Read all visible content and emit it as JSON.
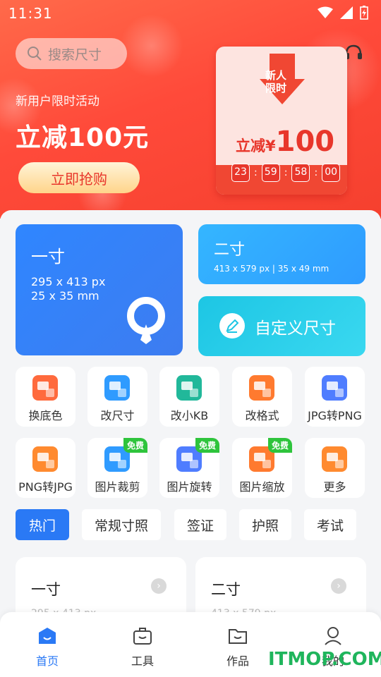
{
  "status": {
    "time": "11:31"
  },
  "search": {
    "placeholder": "搜索尺寸"
  },
  "promo": {
    "subtitle": "新用户限时活动",
    "title": "立减100元",
    "button": "立即抢购",
    "coupon_tag_line1": "新人",
    "coupon_tag_line2": "限时",
    "coupon_price_prefix": "立减¥",
    "coupon_price": "100",
    "timer": [
      "23",
      "59",
      "58",
      "00"
    ]
  },
  "cards": {
    "one": {
      "title": "一寸",
      "px": "295 x 413 px",
      "mm": "25 x 35 mm"
    },
    "two": {
      "title": "二寸",
      "desc": "413 x 579 px | 35 x 49 mm"
    },
    "custom": {
      "title": "自定义尺寸"
    }
  },
  "tools": [
    {
      "label": "换底色",
      "color": "#ff6a3d"
    },
    {
      "label": "改尺寸",
      "color": "#2f9bff"
    },
    {
      "label": "改小KB",
      "color": "#21b89a"
    },
    {
      "label": "改格式",
      "color": "#ff7a2f"
    },
    {
      "label": "JPG转PNG",
      "color": "#4f7dff"
    },
    {
      "label": "PNG转JPG",
      "color": "#ff8a2f"
    },
    {
      "label": "图片裁剪",
      "color": "#2f9bff",
      "badge": "免费"
    },
    {
      "label": "图片旋转",
      "color": "#4f7dff",
      "badge": "免费"
    },
    {
      "label": "图片缩放",
      "color": "#ff7a2f",
      "badge": "免费"
    },
    {
      "label": "更多",
      "color": "#ff8a2f"
    }
  ],
  "tabs": [
    "热门",
    "常规寸照",
    "签证",
    "护照",
    "考试"
  ],
  "list": [
    {
      "title": "一寸",
      "sub": "295 x 413 px"
    },
    {
      "title": "二寸",
      "sub": "413 x 579 px"
    }
  ],
  "nav": [
    "首页",
    "工具",
    "作品",
    "我的"
  ],
  "watermark": "ITMOP.COM",
  "colors": {
    "accent": "#2a79f5",
    "promo_red": "#f5402e",
    "free_green": "#2ec43c"
  }
}
